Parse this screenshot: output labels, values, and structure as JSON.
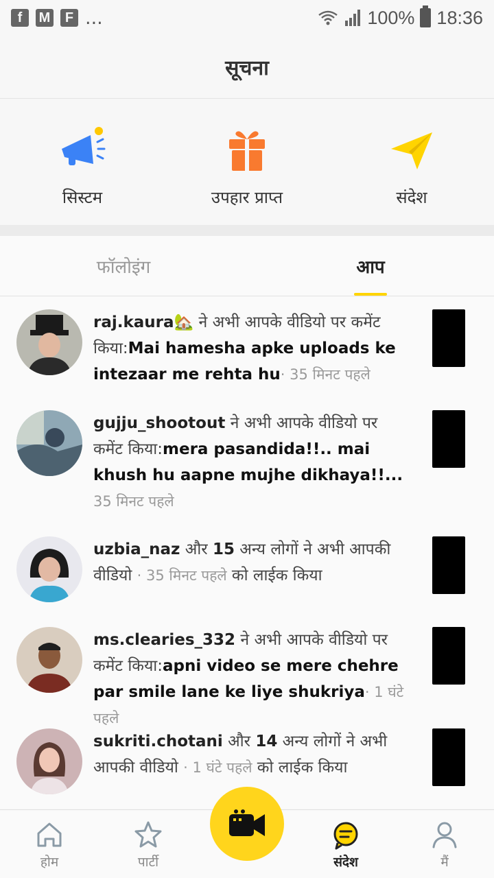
{
  "status_bar": {
    "left_icons": [
      "f",
      "M",
      "F"
    ],
    "ellipsis": "...",
    "battery": "100%",
    "time": "18:36"
  },
  "header": {
    "title": "सूचना"
  },
  "categories": [
    {
      "label": "सिस्टम",
      "icon": "megaphone-icon"
    },
    {
      "label": "उपहार प्राप्त",
      "icon": "gift-icon"
    },
    {
      "label": "संदेश",
      "icon": "send-icon"
    }
  ],
  "tabs": [
    {
      "label": "फॉलोइंग",
      "active": false
    },
    {
      "label": "आप",
      "active": true
    }
  ],
  "notifications": [
    {
      "user": "raj.kaura🏡",
      "text": " ने अभी आपके वीडियो पर कमेंट किया:",
      "message": "Mai hamesha apke uploads ke intezaar me rehta hu",
      "time": "· 35 मिनट पहले",
      "suffix": ""
    },
    {
      "user": "gujju_shootout",
      "text": " ने अभी आपके वीडियो पर कमेंट किया:",
      "message": "mera pasandida!!.. mai khush hu aapne mujhe dikhaya!!...",
      "time": " 35 मिनट पहले",
      "suffix": ""
    },
    {
      "user": "uzbia_naz",
      "text": " और ",
      "count": "15",
      "text2": " अन्य लोगों ने अभी आपकी वीडियो ",
      "time": "· 35 मिनट पहले",
      "suffix": " को लाईक किया"
    },
    {
      "user": "ms.clearies_332",
      "text": " ने अभी आपके वीडियो पर कमेंट किया:",
      "message": "apni video se mere chehre par smile lane ke liye shukriya",
      "time": "· 1 घंटे पहले",
      "suffix": ""
    },
    {
      "user": "sukriti.chotani",
      "text": " और ",
      "count": "14",
      "text2": " अन्य लोगों ने अभी आपकी वीडियो ",
      "time": "· 1 घंटे पहले",
      "suffix": " को लाईक किया"
    }
  ],
  "bottom_nav": [
    {
      "label": "होम",
      "icon": "home-icon"
    },
    {
      "label": "पार्टी",
      "icon": "star-icon"
    },
    {
      "label": "संदेश",
      "icon": "message-icon",
      "active": true
    },
    {
      "label": "मैं",
      "icon": "profile-icon"
    }
  ],
  "colors": {
    "accent": "#ffd400",
    "megaphone": "#3b82f6",
    "gift": "#f97a2f",
    "send": "#ffd400"
  }
}
